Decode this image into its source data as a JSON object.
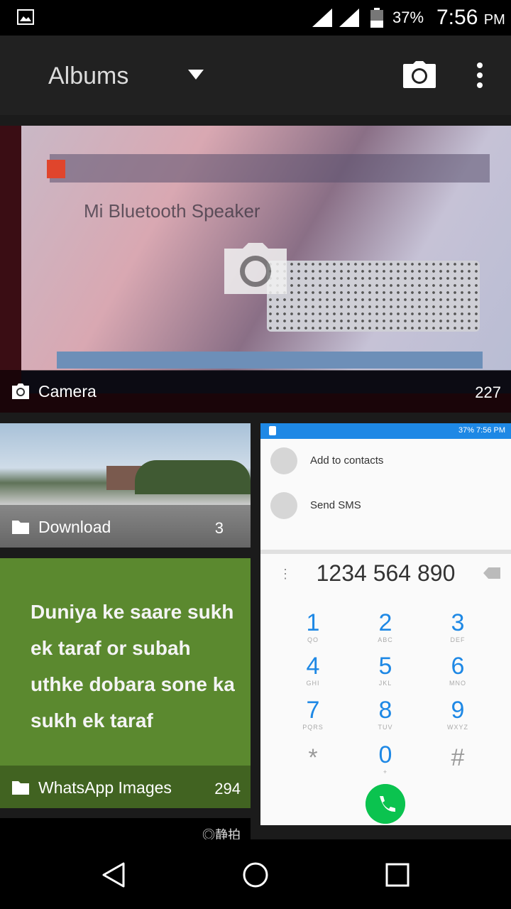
{
  "status_bar": {
    "battery_percent": "37%",
    "time": "7:56",
    "ampm": "PM"
  },
  "action_bar": {
    "title": "Albums",
    "icons": [
      "dropdown-arrow-icon",
      "camera-icon",
      "more-vert-icon"
    ]
  },
  "albums": [
    {
      "name": "Camera",
      "count": "227",
      "icon": "camera-icon",
      "thumbnail_text": "Mi Bluetooth Speaker"
    },
    {
      "name": "Download",
      "count": "3",
      "icon": "folder-icon"
    },
    {
      "name": "WhatsApp Images",
      "count": "294",
      "icon": "folder-icon",
      "thumbnail_text": "Duniya ke saare sukh ek taraf or subah uthke dobara sone ka sukh ek taraf"
    }
  ],
  "dialer_preview": {
    "status_text": "37% 7:56 PM",
    "actions": [
      "Add to contacts",
      "Send SMS"
    ],
    "number": "1234 564 890",
    "keys": [
      {
        "digit": "1",
        "letters": "QO"
      },
      {
        "digit": "2",
        "letters": "ABC"
      },
      {
        "digit": "3",
        "letters": "DEF"
      },
      {
        "digit": "4",
        "letters": "GHI"
      },
      {
        "digit": "5",
        "letters": "JKL"
      },
      {
        "digit": "6",
        "letters": "MNO"
      },
      {
        "digit": "7",
        "letters": "PQRS"
      },
      {
        "digit": "8",
        "letters": "TUV"
      },
      {
        "digit": "9",
        "letters": "WXYZ"
      },
      {
        "digit": "*",
        "letters": ""
      },
      {
        "digit": "0",
        "letters": "+"
      },
      {
        "digit": "#",
        "letters": ""
      }
    ]
  },
  "partial_tile_text": "◎静拍",
  "nav_bar": {
    "buttons": [
      "back-icon",
      "home-icon",
      "recents-icon"
    ]
  },
  "colors": {
    "action_bar": "#212121",
    "whatsapp_tile": "#5b892f",
    "dialer_accent": "#1e88e5",
    "call_button": "#0bc34f"
  }
}
